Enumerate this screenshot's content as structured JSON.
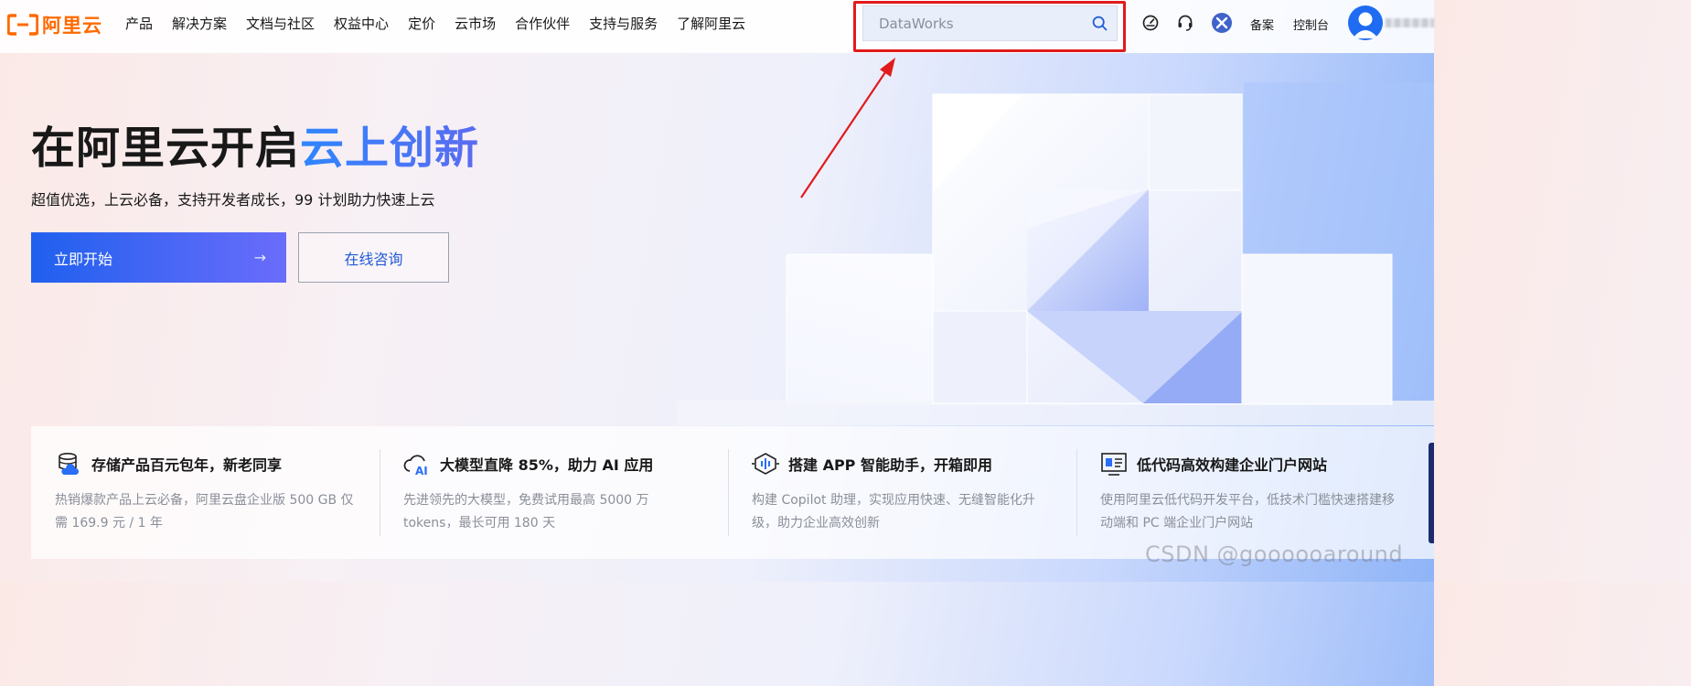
{
  "header": {
    "logo_text": "阿里云",
    "nav": [
      "产品",
      "解决方案",
      "文档与社区",
      "权益中心",
      "定价",
      "云市场",
      "合作伙伴",
      "支持与服务",
      "了解阿里云"
    ],
    "search": {
      "placeholder": "DataWorks"
    },
    "icons": [
      "dashboard-icon",
      "headset-icon",
      "cross-app-icon"
    ],
    "beian_label": "备案",
    "console_label": "控制台"
  },
  "hero": {
    "title_plain": "在阿里云开启",
    "title_highlight": "云上创新",
    "subtitle": "超值优选，上云必备，支持开发者成长，99 计划助力快速上云",
    "primary_button": "立即开始",
    "primary_arrow": "→",
    "secondary_button": "在线咨询"
  },
  "cards": [
    {
      "icon": "storage-cloud-icon",
      "title": "存储产品百元包年，新老同享",
      "desc": "热销爆款产品上云必备，阿里云盘企业版 500 GB 仅需 169.9 元 / 1 年"
    },
    {
      "icon": "cloud-ai-icon",
      "title": "大模型直降 85%，助力 AI 应用",
      "desc": "先进领先的大模型，免费试用最高 5000 万 tokens，最长可用 180 天"
    },
    {
      "icon": "voice-assistant-icon",
      "title": "搭建 APP 智能助手，开箱即用",
      "desc": "构建 Copilot 助理，实现应用快速、无缝智能化升级，助力企业高效创新"
    },
    {
      "icon": "website-builder-icon",
      "title": "低代码高效构建企业门户网站",
      "desc": "使用阿里云低代码开发平台，低技术门槛快速搭建移动端和 PC 端企业门户网站"
    }
  ],
  "watermark": "CSDN @goooooaround",
  "colors": {
    "brand_orange": "#ff6a00",
    "primary_blue": "#1f60ee",
    "highlight_outline": "#e11b1b",
    "annotation_arrow": "#e11b1b"
  }
}
